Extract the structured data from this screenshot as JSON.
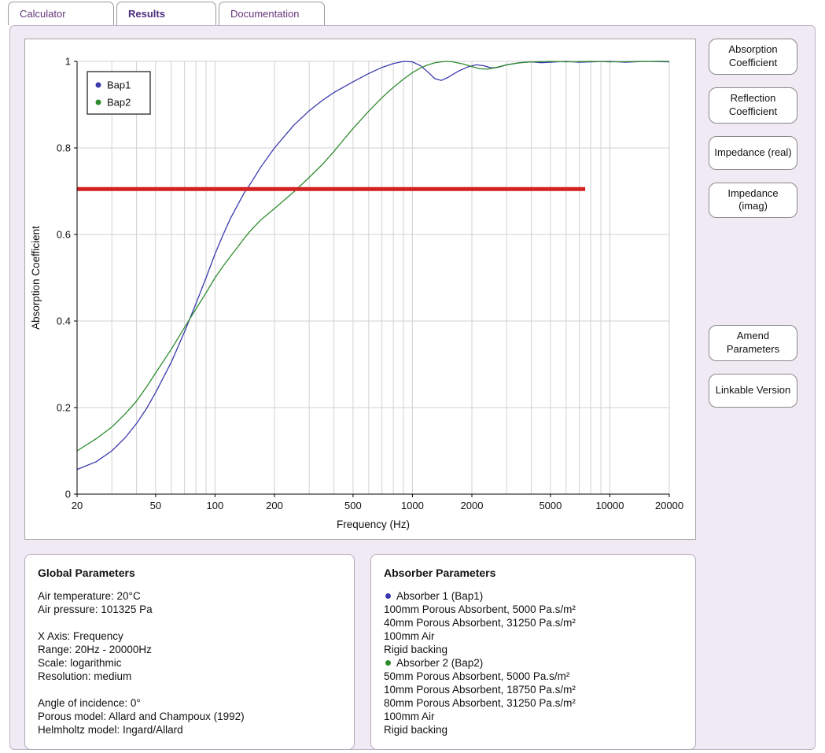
{
  "colors": {
    "accent_purple": "#66337a",
    "panel_background": "#efeaf4",
    "series_blue": "#3a3aad",
    "series_green": "#2e8b2e",
    "threshold_red": "#d42020"
  },
  "tabs": [
    {
      "label": "Calculator",
      "active": false
    },
    {
      "label": "Results",
      "active": true
    },
    {
      "label": "Documentation",
      "active": false
    }
  ],
  "side_buttons": {
    "view_buttons": [
      "Absorption Coefficient",
      "Reflection Coefficient",
      "Impedance (real)",
      "Impedance (imag)"
    ],
    "action_buttons": [
      "Amend Parameters",
      "Linkable Version"
    ]
  },
  "chart_data": {
    "type": "line",
    "title": "",
    "xlabel": "Frequency (Hz)",
    "ylabel": "Absorption Coefficient",
    "x_scale": "log",
    "xlim": [
      20,
      20000
    ],
    "ylim": [
      0,
      1
    ],
    "x_ticks": [
      20,
      50,
      100,
      200,
      500,
      1000,
      2000,
      5000,
      10000,
      20000
    ],
    "y_ticks": [
      0,
      0.2,
      0.4,
      0.6,
      0.8,
      1
    ],
    "grid": true,
    "legend_position": "top-left",
    "series": [
      {
        "name": "Bap1",
        "color": "#3a3aad",
        "points": [
          [
            20,
            0.057
          ],
          [
            25,
            0.075
          ],
          [
            30,
            0.1
          ],
          [
            35,
            0.13
          ],
          [
            40,
            0.163
          ],
          [
            45,
            0.198
          ],
          [
            50,
            0.235
          ],
          [
            60,
            0.305
          ],
          [
            70,
            0.375
          ],
          [
            80,
            0.44
          ],
          [
            90,
            0.5
          ],
          [
            100,
            0.555
          ],
          [
            110,
            0.6
          ],
          [
            120,
            0.638
          ],
          [
            140,
            0.695
          ],
          [
            150,
            0.715
          ],
          [
            170,
            0.755
          ],
          [
            200,
            0.8
          ],
          [
            250,
            0.852
          ],
          [
            300,
            0.886
          ],
          [
            350,
            0.91
          ],
          [
            400,
            0.928
          ],
          [
            500,
            0.953
          ],
          [
            600,
            0.972
          ],
          [
            700,
            0.986
          ],
          [
            800,
            0.995
          ],
          [
            900,
            1.0
          ],
          [
            1000,
            0.999
          ],
          [
            1100,
            0.99
          ],
          [
            1200,
            0.975
          ],
          [
            1300,
            0.96
          ],
          [
            1400,
            0.956
          ],
          [
            1500,
            0.962
          ],
          [
            1700,
            0.977
          ],
          [
            1900,
            0.987
          ],
          [
            2100,
            0.992
          ],
          [
            2300,
            0.99
          ],
          [
            2500,
            0.985
          ],
          [
            2700,
            0.986
          ],
          [
            3000,
            0.992
          ],
          [
            3500,
            0.997
          ],
          [
            4000,
            0.999
          ],
          [
            4500,
            0.997
          ],
          [
            5000,
            0.998
          ],
          [
            6000,
            1.0
          ],
          [
            7000,
            0.998
          ],
          [
            8000,
            0.999
          ],
          [
            10000,
            1.0
          ],
          [
            12000,
            0.998
          ],
          [
            15000,
            1.0
          ],
          [
            20000,
            0.999
          ]
        ]
      },
      {
        "name": "Bap2",
        "color": "#2e8b2e",
        "points": [
          [
            20,
            0.1
          ],
          [
            25,
            0.128
          ],
          [
            30,
            0.155
          ],
          [
            35,
            0.185
          ],
          [
            40,
            0.215
          ],
          [
            45,
            0.248
          ],
          [
            50,
            0.28
          ],
          [
            60,
            0.335
          ],
          [
            70,
            0.385
          ],
          [
            80,
            0.428
          ],
          [
            90,
            0.465
          ],
          [
            100,
            0.5
          ],
          [
            110,
            0.527
          ],
          [
            120,
            0.55
          ],
          [
            140,
            0.59
          ],
          [
            150,
            0.607
          ],
          [
            170,
            0.633
          ],
          [
            200,
            0.66
          ],
          [
            250,
            0.698
          ],
          [
            300,
            0.732
          ],
          [
            350,
            0.762
          ],
          [
            400,
            0.792
          ],
          [
            450,
            0.82
          ],
          [
            500,
            0.845
          ],
          [
            600,
            0.885
          ],
          [
            700,
            0.916
          ],
          [
            800,
            0.94
          ],
          [
            900,
            0.959
          ],
          [
            1000,
            0.974
          ],
          [
            1100,
            0.985
          ],
          [
            1200,
            0.992
          ],
          [
            1300,
            0.997
          ],
          [
            1400,
            0.999
          ],
          [
            1500,
            1.0
          ],
          [
            1600,
            0.999
          ],
          [
            1800,
            0.994
          ],
          [
            2000,
            0.988
          ],
          [
            2200,
            0.983
          ],
          [
            2400,
            0.982
          ],
          [
            2600,
            0.985
          ],
          [
            3000,
            0.992
          ],
          [
            3500,
            0.997
          ],
          [
            4000,
            0.999
          ],
          [
            5000,
            1.0
          ],
          [
            6000,
            0.999
          ],
          [
            8000,
            1.0
          ],
          [
            10000,
            0.999
          ],
          [
            15000,
            1.0
          ],
          [
            20000,
            1.0
          ]
        ]
      }
    ],
    "threshold_line": {
      "color": "#d42020",
      "y": 0.705,
      "x_start": 20,
      "x_end": 7500,
      "width": 5
    }
  },
  "global_parameters": {
    "title": "Global Parameters",
    "lines": [
      "Air temperature: 20°C",
      "Air pressure: 101325 Pa",
      "",
      "X Axis: Frequency",
      "Range: 20Hz - 20000Hz",
      "Scale: logarithmic",
      "Resolution: medium",
      "",
      "Angle of incidence: 0°",
      "Porous model: Allard and Champoux (1992)",
      "Helmholtz model: Ingard/Allard"
    ]
  },
  "absorber_parameters": {
    "title": "Absorber Parameters",
    "absorbers": [
      {
        "name": "Absorber 1 (Bap1)",
        "color": "#3a3aad",
        "layers": [
          "100mm Porous Absorbent, 5000 Pa.s/m²",
          "40mm Porous Absorbent, 31250 Pa.s/m²",
          "100mm Air",
          "Rigid backing"
        ]
      },
      {
        "name": "Absorber 2 (Bap2)",
        "color": "#2e8b2e",
        "layers": [
          "50mm Porous Absorbent, 5000 Pa.s/m²",
          "10mm Porous Absorbent, 18750 Pa.s/m²",
          "80mm Porous Absorbent, 31250 Pa.s/m²",
          "100mm Air",
          "Rigid backing"
        ]
      }
    ]
  }
}
